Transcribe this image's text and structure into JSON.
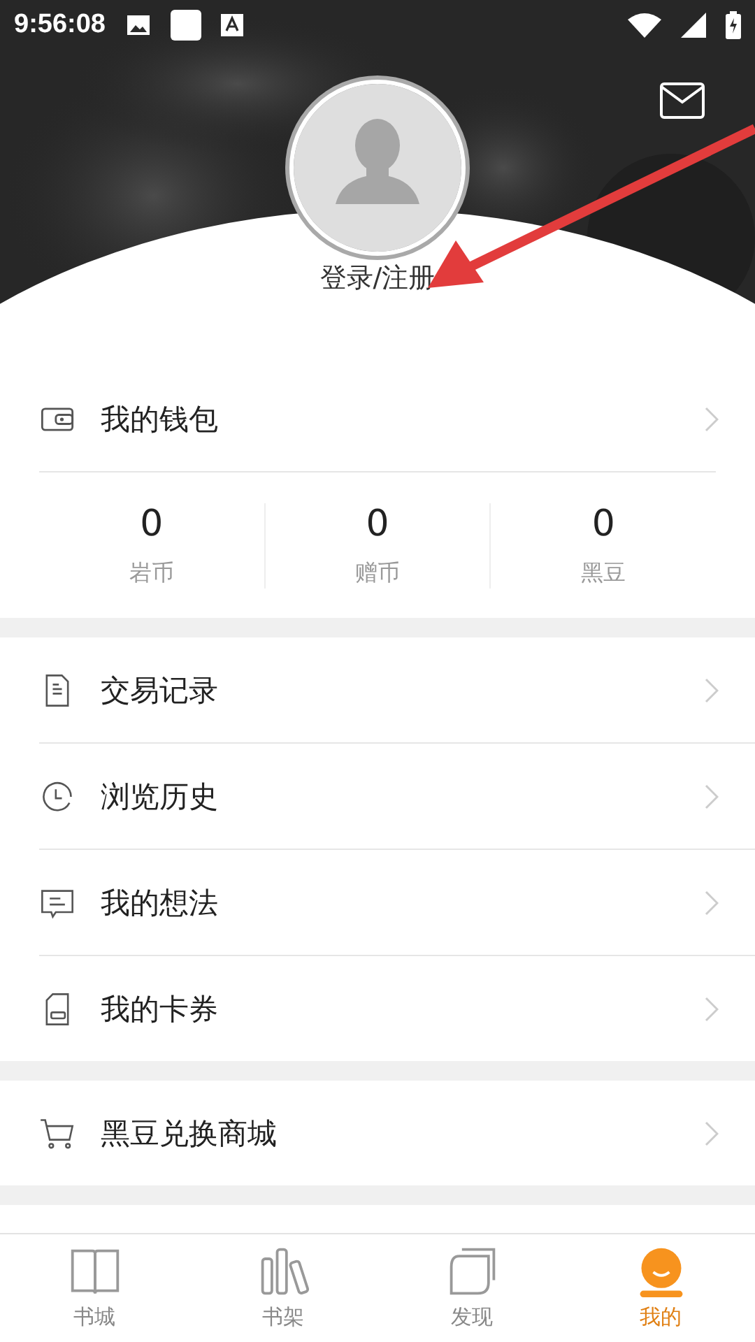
{
  "status_bar": {
    "time": "9:56:08"
  },
  "profile": {
    "login_label": "登录/注册"
  },
  "wallet": {
    "title": "我的钱包",
    "stats": [
      {
        "value": "0",
        "label": "岩币"
      },
      {
        "value": "0",
        "label": "赠币"
      },
      {
        "value": "0",
        "label": "黑豆"
      }
    ]
  },
  "menu": [
    {
      "kind": "receipt",
      "label": "交易记录"
    },
    {
      "kind": "clock",
      "label": "浏览历史"
    },
    {
      "kind": "comment",
      "label": "我的想法"
    },
    {
      "kind": "card",
      "label": "我的卡券"
    }
  ],
  "shop": {
    "kind": "cart",
    "label": "黑豆兑换商城"
  },
  "tabs": [
    {
      "kind": "book",
      "label": "书城",
      "selected": false
    },
    {
      "kind": "shelf",
      "label": "书架",
      "selected": false
    },
    {
      "kind": "discover",
      "label": "发现",
      "selected": false
    },
    {
      "kind": "me",
      "label": "我的",
      "selected": true
    }
  ]
}
